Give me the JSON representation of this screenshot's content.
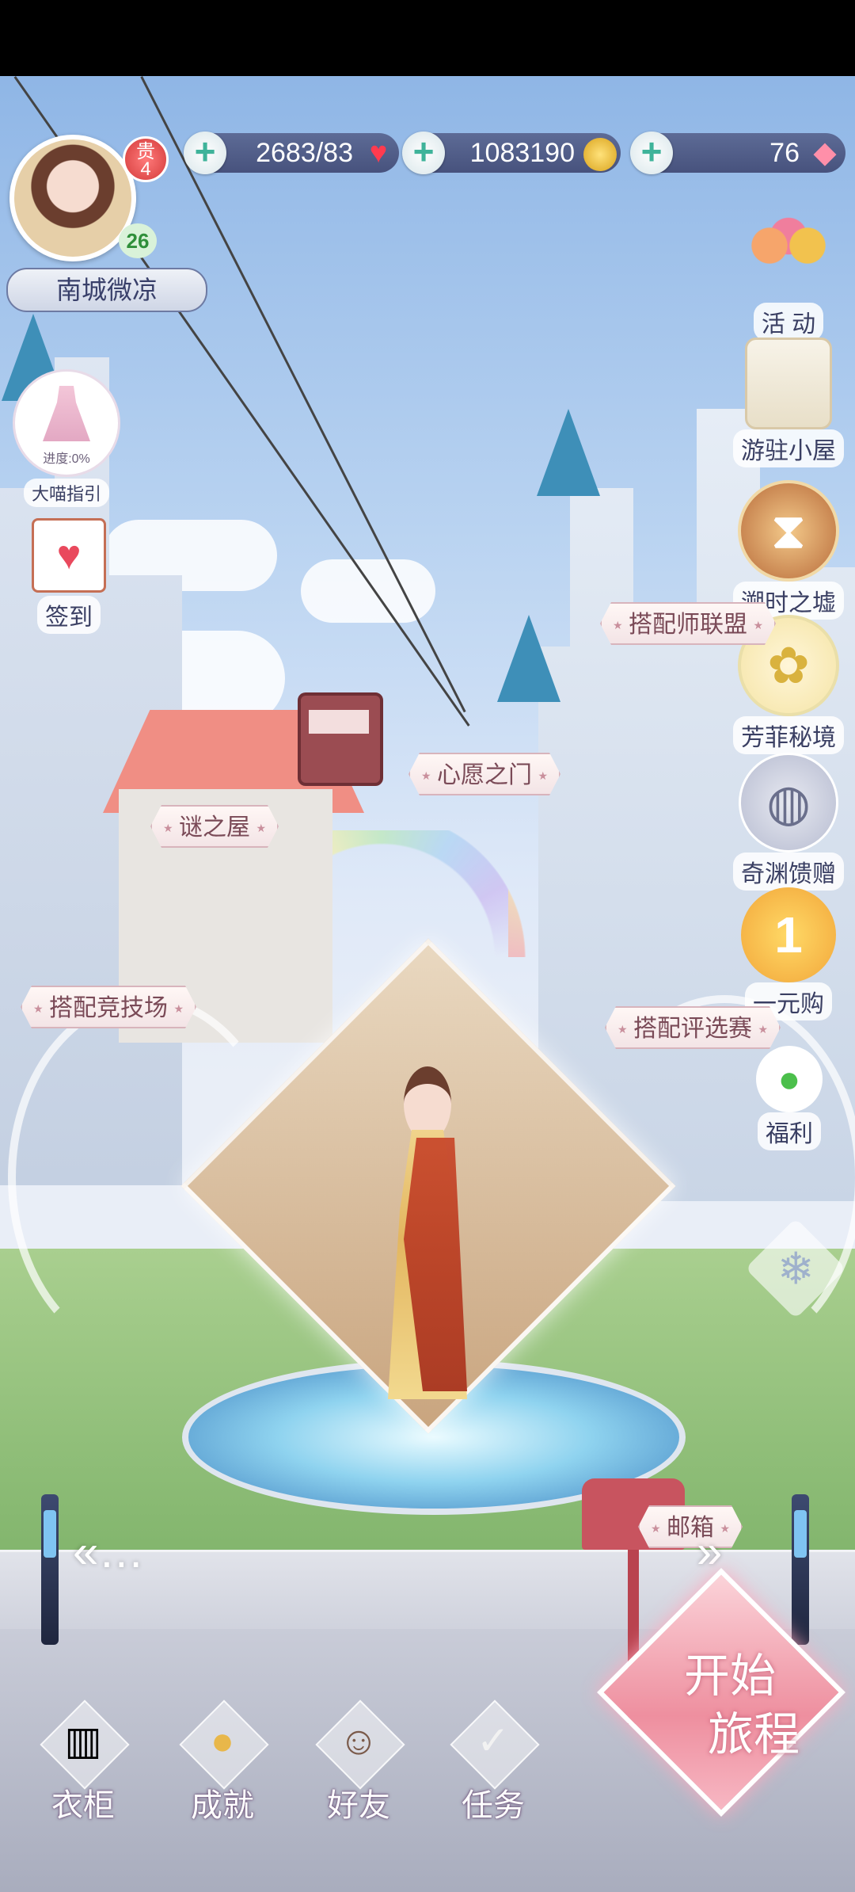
{
  "player": {
    "name": "南城微凉",
    "vip_label": "贵",
    "vip_level": "4",
    "level": "26"
  },
  "resources": {
    "stamina": "2683/83",
    "coins": "1083190",
    "diamonds": "76",
    "plus_symbol": "+"
  },
  "left_menu": {
    "guide_label": "大喵指引",
    "guide_progress": "进度:0%",
    "checkin_label": "签到"
  },
  "right_menu": {
    "items": [
      {
        "label": "活 动",
        "icon": "balloon-icon"
      },
      {
        "label": "游驻小屋",
        "icon": "cabin-icon"
      },
      {
        "label": "溯时之墟",
        "icon": "hourglass-icon"
      },
      {
        "label": "芳菲秘境",
        "icon": "fairy-icon"
      },
      {
        "label": "奇渊馈赠",
        "icon": "shell-icon"
      },
      {
        "label": "一元购",
        "icon": "coin-icon"
      },
      {
        "label": "福利",
        "icon": "chat-icon"
      }
    ]
  },
  "locations": {
    "stylist_alliance": "搭配师联盟",
    "wish_gate": "心愿之门",
    "mystery_house": "谜之屋",
    "arena": "搭配竞技场",
    "competition": "搭配评选赛",
    "mailbox": "邮箱"
  },
  "bottom_nav": {
    "wardrobe": "衣柜",
    "achievements": "成就",
    "friends": "好友",
    "tasks": "任务"
  },
  "start_button": {
    "line1": "开始",
    "line2": "旅程"
  },
  "arrows": {
    "left": "«…",
    "right": "»"
  }
}
